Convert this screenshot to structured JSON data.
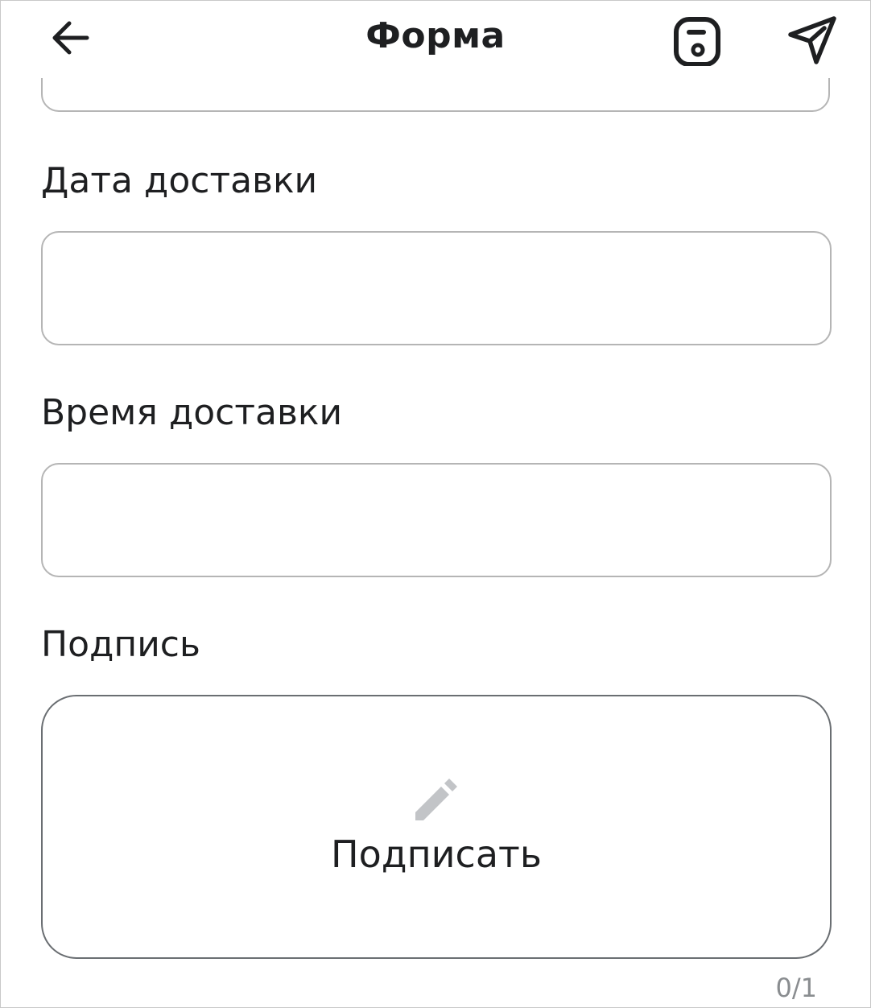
{
  "header": {
    "title": "Форма",
    "back_icon": "arrow-left-icon",
    "save_icon": "save-icon",
    "send_icon": "send-icon"
  },
  "fields": {
    "delivery_date": {
      "label": "Дата доставки",
      "value": ""
    },
    "delivery_time": {
      "label": "Время доставки",
      "value": ""
    },
    "signature": {
      "label": "Подпись",
      "button_label": "Подписать",
      "icon": "pencil-icon",
      "counter": "0/1"
    }
  },
  "colors": {
    "text": "#1e1f21",
    "border": "#b5b5b5",
    "signature_border": "#6a6e72",
    "pencil": "#c2c4c7",
    "counter": "#8a8d90"
  }
}
